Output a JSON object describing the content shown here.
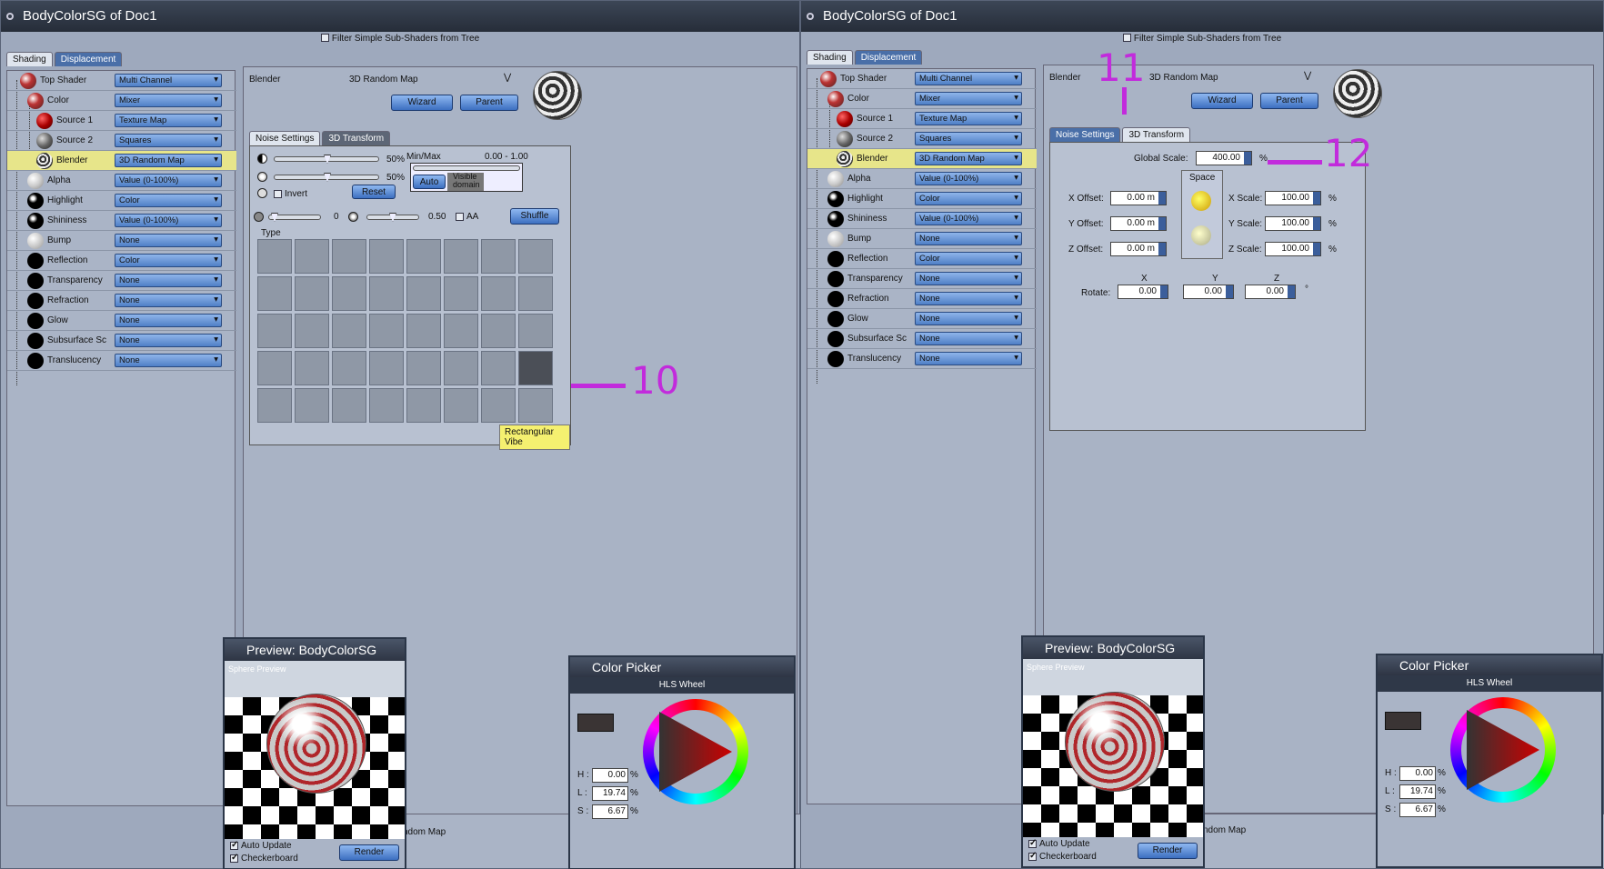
{
  "window_title": "BodyColorSG of Doc1",
  "filter_label": "Filter Simple Sub-Shaders from Tree",
  "main_tabs": [
    "Shading",
    "Displacement"
  ],
  "tree": [
    {
      "label": "Top Shader",
      "value": "Multi Channel"
    },
    {
      "label": "Color",
      "value": "Mixer"
    },
    {
      "label": "Source 1",
      "value": "Texture Map"
    },
    {
      "label": "Source 2",
      "value": "Squares"
    },
    {
      "label": "Blender",
      "value": "3D Random Map"
    },
    {
      "label": "Alpha",
      "value": "Value (0-100%)"
    },
    {
      "label": "Highlight",
      "value": "Color"
    },
    {
      "label": "Shininess",
      "value": "Value (0-100%)"
    },
    {
      "label": "Bump",
      "value": "None"
    },
    {
      "label": "Reflection",
      "value": "Color"
    },
    {
      "label": "Transparency",
      "value": "None"
    },
    {
      "label": "Refraction",
      "value": "None"
    },
    {
      "label": "Glow",
      "value": "None"
    },
    {
      "label": "Subsurface Sc",
      "value": "None"
    },
    {
      "label": "Translucency",
      "value": "None"
    }
  ],
  "editor": {
    "channel": "Blender",
    "shader": "3D Random Map",
    "wizard": "Wizard",
    "parent": "Parent",
    "tabs": [
      "Noise Settings",
      "3D Transform"
    ]
  },
  "noise": {
    "pct1": "50%",
    "pct2": "50%",
    "minmax_label": "Min/Max",
    "minmax_value": "0.00 - 1.00",
    "invert": "Invert",
    "reset": "Reset",
    "auto": "Auto",
    "visible_domain": "Visible domain",
    "val_a": "0",
    "val_b": "0.50",
    "aa": "AA",
    "shuffle": "Shuffle",
    "type_label": "Type",
    "tooltip": "Rectangular Vibe"
  },
  "transform": {
    "global_scale_label": "Global Scale:",
    "global_scale": "400.00",
    "pct": "%",
    "space": "Space",
    "x_offset_label": "X Offset:",
    "y_offset_label": "Y Offset:",
    "z_offset_label": "Z Offset:",
    "x_offset": "0.00 m",
    "y_offset": "0.00 m",
    "z_offset": "0.00 m",
    "x_scale_label": "X Scale:",
    "y_scale_label": "Y Scale:",
    "z_scale_label": "Z Scale:",
    "x_scale": "100.00",
    "y_scale": "100.00",
    "z_scale": "100.00",
    "rotate_label": "Rotate:",
    "axis_x": "X",
    "axis_y": "Y",
    "axis_z": "Z",
    "rot_x": "0.00",
    "rot_y": "0.00",
    "rot_z": "0.00",
    "deg": "°"
  },
  "preview": {
    "title": "Preview: BodyColorSG",
    "sphere_label": "Sphere Preview",
    "auto_update": "Auto Update",
    "checkboard": "Checkerboard",
    "render": "Render"
  },
  "picker": {
    "title": "Color Picker",
    "mode": "HLS Wheel",
    "h_label": "H :",
    "l_label": "L :",
    "s_label": "S :",
    "h": "0.00",
    "l": "19.74",
    "s": "6.67",
    "pct": "%"
  },
  "bottom_partial": "ndom Map",
  "annotations": {
    "a10": "10",
    "a11": "11",
    "a12": "12"
  },
  "colors": {
    "accent": "#c22bdc",
    "highlight_row": "#e7e58a",
    "button": "#4f7fc6"
  }
}
